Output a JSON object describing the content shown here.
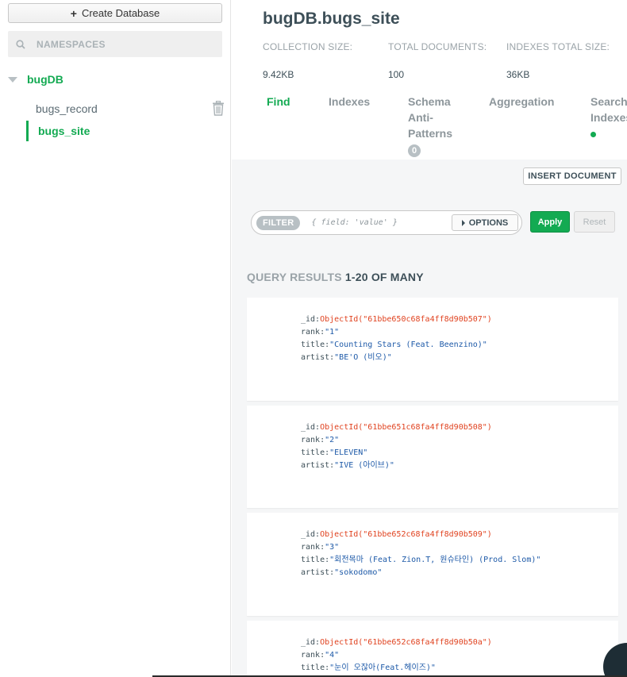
{
  "sidebar": {
    "create_db_label": "Create Database",
    "search_placeholder": "NAMESPACES",
    "database": "bugDB",
    "collections": [
      "bugs_record",
      "bugs_site"
    ],
    "active_collection": "bugs_site"
  },
  "header": {
    "title": "bugDB.bugs_site",
    "stats": [
      {
        "label": "COLLECTION SIZE:",
        "value": "9.42KB"
      },
      {
        "label": "TOTAL DOCUMENTS:",
        "value": "100"
      },
      {
        "label": "INDEXES TOTAL SIZE:",
        "value": "36KB"
      }
    ],
    "tabs": [
      "Find",
      "Indexes",
      "Schema Anti-Patterns",
      "Aggregation",
      "Search Indexes"
    ],
    "schema_badge": "0",
    "active_tab": "Find"
  },
  "toolbar": {
    "insert_label": "INSERT DOCUMENT",
    "filter_label": "FILTER",
    "filter_placeholder": "{ field: 'value' }",
    "options_label": "OPTIONS",
    "apply_label": "Apply",
    "reset_label": "Reset"
  },
  "results": {
    "label": "QUERY RESULTS",
    "count": "1-20 OF MANY",
    "documents": [
      {
        "_id": "ObjectId(\"61bbe650c68fa4ff8d90b507\")",
        "rank": "\"1\"",
        "title": "\"Counting Stars (Feat. Beenzino)\"",
        "artist": "\"BE'O (비오)\""
      },
      {
        "_id": "ObjectId(\"61bbe651c68fa4ff8d90b508\")",
        "rank": "\"2\"",
        "title": "\"ELEVEN\"",
        "artist": "\"IVE (아이브)\""
      },
      {
        "_id": "ObjectId(\"61bbe652c68fa4ff8d90b509\")",
        "rank": "\"3\"",
        "title": "\"회전목마 (Feat. Zion.T, 원슈타인) (Prod. Slom)\"",
        "artist": "\"sokodomo\""
      },
      {
        "_id": "ObjectId(\"61bbe652c68fa4ff8d90b50a\")",
        "rank": "\"4\"",
        "title": "\"눈이 오잖아(Feat.헤이즈)\"",
        "artist": ""
      }
    ]
  },
  "colors": {
    "accent": "#13aa52",
    "object_id": "#e0421f",
    "string": "#1e5aa8"
  }
}
